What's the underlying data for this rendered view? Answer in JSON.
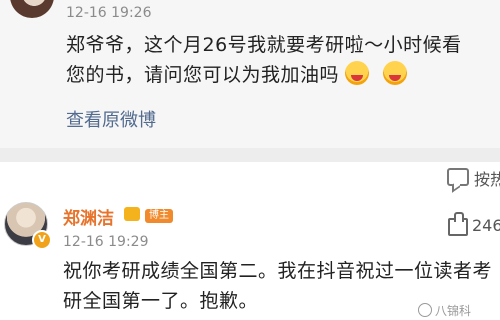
{
  "comment1": {
    "time": "12-16 19:26",
    "text_line1": "郑爷爷，这个月26号我就要考研啦～小时候看",
    "text_line2": "您的书，请问您可以为我加油吗",
    "emojis": [
      "smile-emoji",
      "smile-emoji"
    ],
    "view_original": "查看原微博",
    "reply_label": "按热"
  },
  "comment2": {
    "author": "郑渊洁",
    "badge": "博主",
    "time": "12-16 19:29",
    "likes": "246",
    "text_line1": "祝你考研成绩全国第二。我在抖音祝过一位读者考",
    "text_line2": "研全国第一了。抱歉。",
    "verified": "V"
  },
  "watermark": "八锦科"
}
